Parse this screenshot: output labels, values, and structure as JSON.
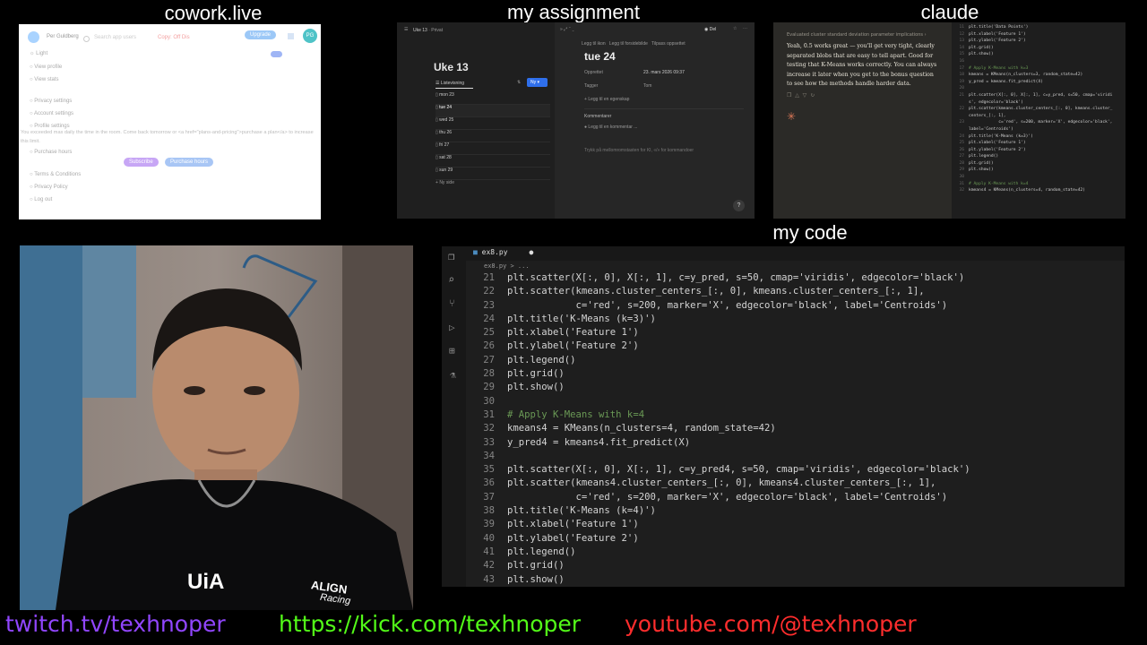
{
  "labels": {
    "cowork": "cowork.live",
    "assignment": "my assignment",
    "claude": "claude",
    "code": "my code"
  },
  "cowork": {
    "user": "Per Guldberg",
    "search_placeholder": "Search app users",
    "status": "Copy: Off Dis",
    "upgrade": "Upgrade",
    "avatar": "PG",
    "menu": [
      "Light",
      "View profile",
      "View stats",
      "Privacy settings",
      "Account settings",
      "Profile settings",
      "Purchase hours",
      "Terms & Conditions",
      "Privacy Policy",
      "Log out"
    ],
    "notice": "You exceeded max daily the time in the room. Come back tomorrow or <a href=\"plans-and-pricing\">purchase a plan</a> to increase this limit.",
    "subscribe": "Subscribe",
    "purchase_hours": "Purchase hours"
  },
  "assignment": {
    "breadcrumb": [
      "Uke 13",
      "Privat"
    ],
    "share": "Del",
    "week_title": "Uke 13",
    "view": "Listevisning",
    "new_btn": "Ny",
    "days": [
      "mon 23",
      "tue 24",
      "wed 25",
      "thu 26",
      "fri 27",
      "sat 28",
      "sun 29"
    ],
    "new_page": "Ny side",
    "actions": [
      "Legg til ikon",
      "Legg til forsidebilde",
      "Tilpass oppsettet"
    ],
    "page_title": "tue 24",
    "props": [
      {
        "k": "Opprettet",
        "v": "23. mars 2026 09:37"
      },
      {
        "k": "Tagger",
        "v": "Tom"
      }
    ],
    "add_prop": "Legg til en egenskap",
    "comments_label": "Kommentarer",
    "comment_placeholder": "Legg til en kommentar ...",
    "hint": "Trykk på mellomromstasten for KI, «/» for kommandoer"
  },
  "claude": {
    "header": "Evaluated cluster standard deviation parameter implications",
    "message": "Yeah, 0.5 works great — you'll get very tight, clearly separated blobs that are easy to tell apart. Good for testing that K-Means works correctly. You can always increase it later when you get to the bonus question to see how the methods handle harder data.",
    "code_lines": [
      {
        "n": "11",
        "t": "plt.title('Data Points')"
      },
      {
        "n": "12",
        "t": "plt.xlabel('Feature 1')"
      },
      {
        "n": "13",
        "t": "plt.ylabel('Feature 2')"
      },
      {
        "n": "14",
        "t": "plt.grid()"
      },
      {
        "n": "15",
        "t": "plt.show()"
      },
      {
        "n": "16",
        "t": ""
      },
      {
        "n": "17",
        "t": "# Apply K-Means with k=3"
      },
      {
        "n": "18",
        "t": "kmeans = KMeans(n_clusters=3, random_state=42)"
      },
      {
        "n": "19",
        "t": "y_pred = kmeans.fit_predict(X)"
      },
      {
        "n": "20",
        "t": ""
      },
      {
        "n": "21",
        "t": "plt.scatter(X[:, 0], X[:, 1], c=y_pred, s=50, cmap='viridi"
      },
      {
        "n": "",
        "t": "s', edgecolor='black')"
      },
      {
        "n": "22",
        "t": "plt.scatter(kmeans.cluster_centers_[:, 0], kmeans.cluster_"
      },
      {
        "n": "",
        "t": "centers_[:, 1],"
      },
      {
        "n": "23",
        "t": "            c='red', s=200, marker='X', edgecolor='black',"
      },
      {
        "n": "",
        "t": "label='Centroids')"
      },
      {
        "n": "24",
        "t": "plt.title('K-Means (k=3)')"
      },
      {
        "n": "25",
        "t": "plt.xlabel('Feature 1')"
      },
      {
        "n": "26",
        "t": "plt.ylabel('Feature 2')"
      },
      {
        "n": "27",
        "t": "plt.legend()"
      },
      {
        "n": "28",
        "t": "plt.grid()"
      },
      {
        "n": "29",
        "t": "plt.show()"
      },
      {
        "n": "30",
        "t": ""
      },
      {
        "n": "31",
        "t": "# Apply K-Means with k=4"
      },
      {
        "n": "32",
        "t": "kmeans4 = KMeans(n_clusters=4, random_state=42)"
      }
    ]
  },
  "webcam": {
    "shirt_text_1": "UiA",
    "shirt_text_2": "ALIGN",
    "shirt_text_3": "Racing"
  },
  "code": {
    "tab": "ex8.py",
    "breadcrumb": "ex8.py > ...",
    "lines": [
      {
        "n": "21",
        "t": "plt.scatter(X[:, 0], X[:, 1], c=y_pred, s=50, cmap='viridis', edgecolor='black')"
      },
      {
        "n": "22",
        "t": "plt.scatter(kmeans.cluster_centers_[:, 0], kmeans.cluster_centers_[:, 1],"
      },
      {
        "n": "23",
        "t": "            c='red', s=200, marker='X', edgecolor='black', label='Centroids')"
      },
      {
        "n": "24",
        "t": "plt.title('K-Means (k=3)')"
      },
      {
        "n": "25",
        "t": "plt.xlabel('Feature 1')"
      },
      {
        "n": "26",
        "t": "plt.ylabel('Feature 2')"
      },
      {
        "n": "27",
        "t": "plt.legend()"
      },
      {
        "n": "28",
        "t": "plt.grid()"
      },
      {
        "n": "29",
        "t": "plt.show()"
      },
      {
        "n": "30",
        "t": ""
      },
      {
        "n": "31",
        "t": "# Apply K-Means with k=4"
      },
      {
        "n": "32",
        "t": "kmeans4 = KMeans(n_clusters=4, random_state=42)"
      },
      {
        "n": "33",
        "t": "y_pred4 = kmeans4.fit_predict(X)"
      },
      {
        "n": "34",
        "t": ""
      },
      {
        "n": "35",
        "t": "plt.scatter(X[:, 0], X[:, 1], c=y_pred4, s=50, cmap='viridis', edgecolor='black')"
      },
      {
        "n": "36",
        "t": "plt.scatter(kmeans4.cluster_centers_[:, 0], kmeans4.cluster_centers_[:, 1],"
      },
      {
        "n": "37",
        "t": "            c='red', s=200, marker='X', edgecolor='black', label='Centroids')"
      },
      {
        "n": "38",
        "t": "plt.title('K-Means (k=4)')"
      },
      {
        "n": "39",
        "t": "plt.xlabel('Feature 1')"
      },
      {
        "n": "40",
        "t": "plt.ylabel('Feature 2')"
      },
      {
        "n": "41",
        "t": "plt.legend()"
      },
      {
        "n": "42",
        "t": "plt.grid()"
      },
      {
        "n": "43",
        "t": "plt.show()"
      }
    ]
  },
  "socials": {
    "twitch": "twitch.tv/texhnoper",
    "kick": "https://kick.com/texhnoper",
    "youtube": "youtube.com/@texhnoper"
  },
  "colors": {
    "twitch": "#9146ff",
    "kick": "#53fc18",
    "youtube": "#ff2d2d",
    "accent_blue": "#2f6feb"
  }
}
